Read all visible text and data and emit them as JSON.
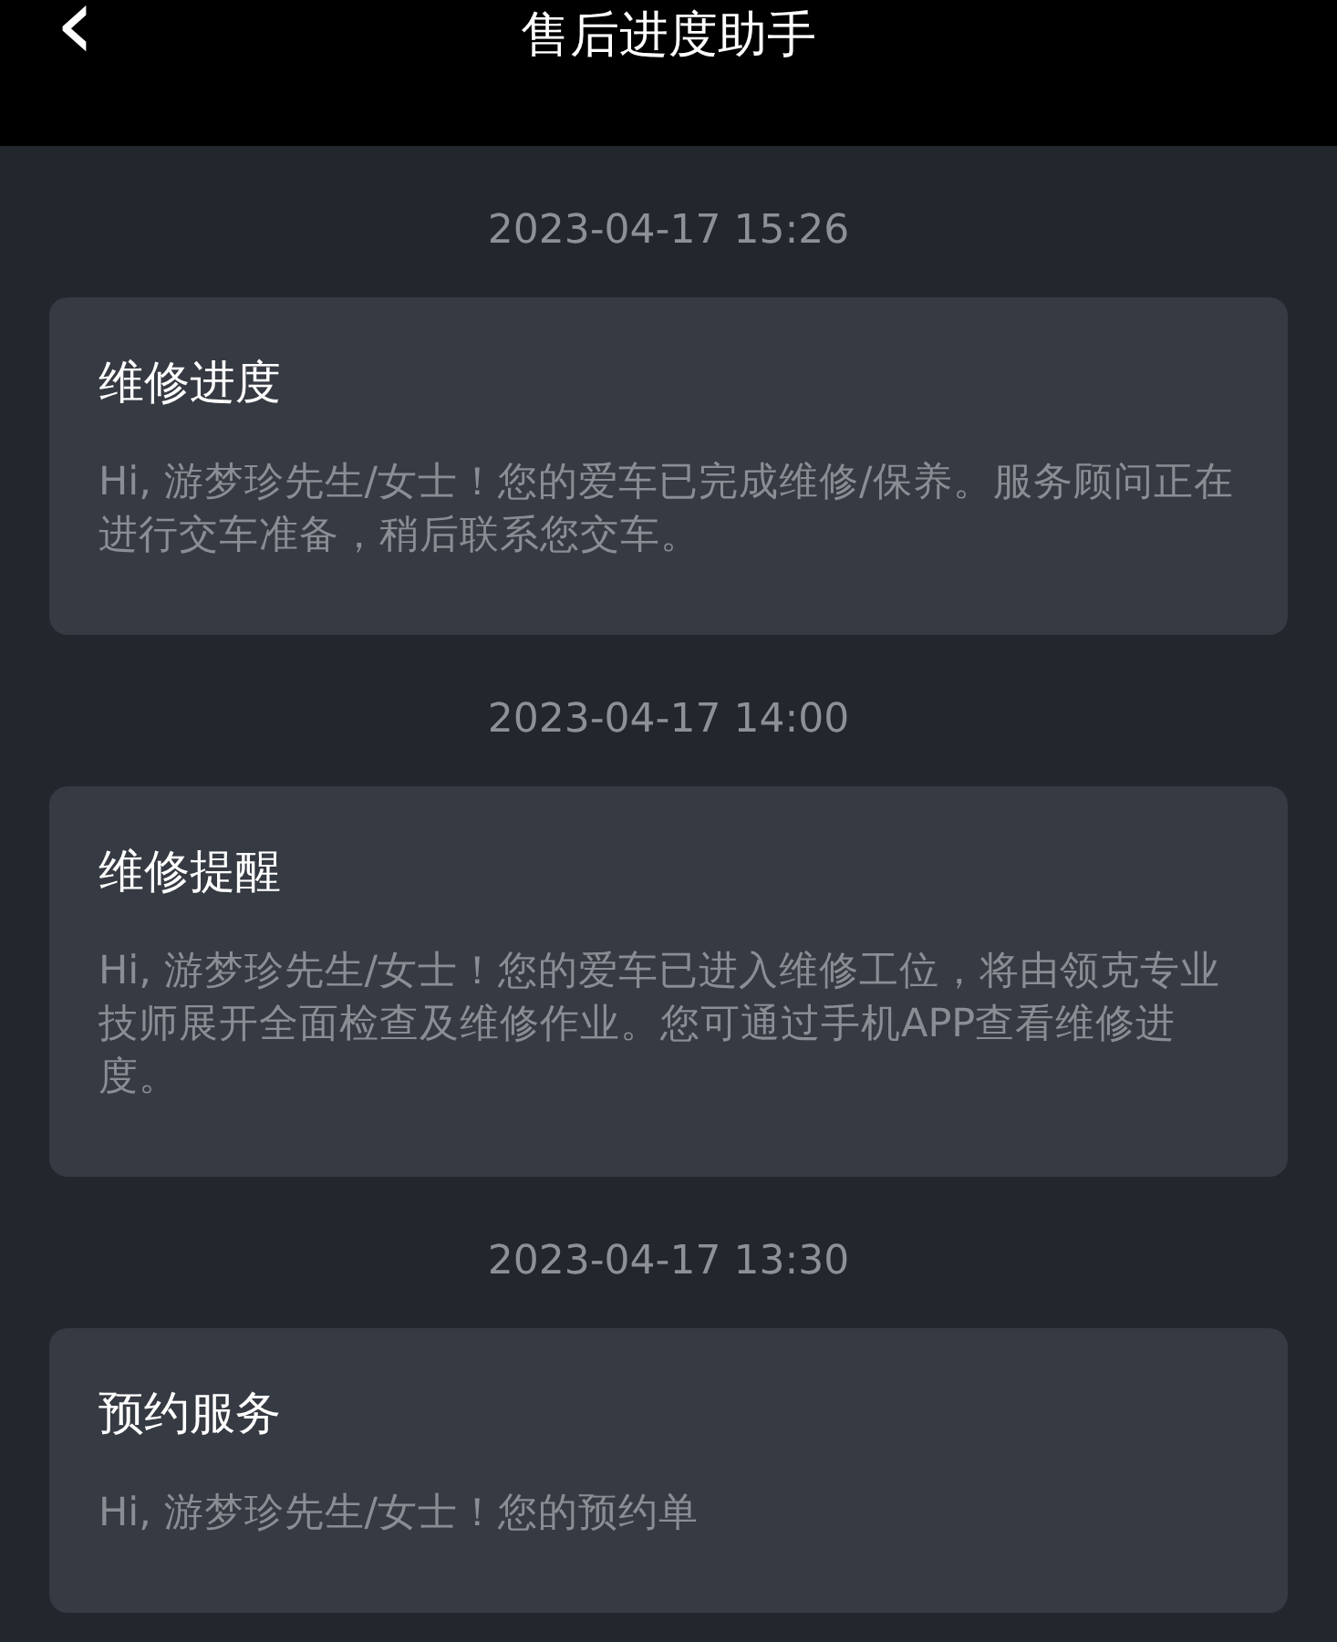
{
  "header": {
    "back": "‹",
    "title": "售后进度助手"
  },
  "messages": [
    {
      "time": "2023-04-17 15:26",
      "title": "维修进度",
      "body": "Hi, 游梦珍先生/女士！您的爱车已完成维修/保养。服务顾问正在进行交车准备，稍后联系您交车。"
    },
    {
      "time": "2023-04-17 14:00",
      "title": "维修提醒",
      "body": "Hi, 游梦珍先生/女士！您的爱车已进入维修工位，将由领克专业技师展开全面检查及维修作业。您可通过手机APP查看维修进度。"
    },
    {
      "time": "2023-04-17 13:30",
      "title": "预约服务",
      "body": "Hi, 游梦珍先生/女士！您的预约单"
    }
  ]
}
